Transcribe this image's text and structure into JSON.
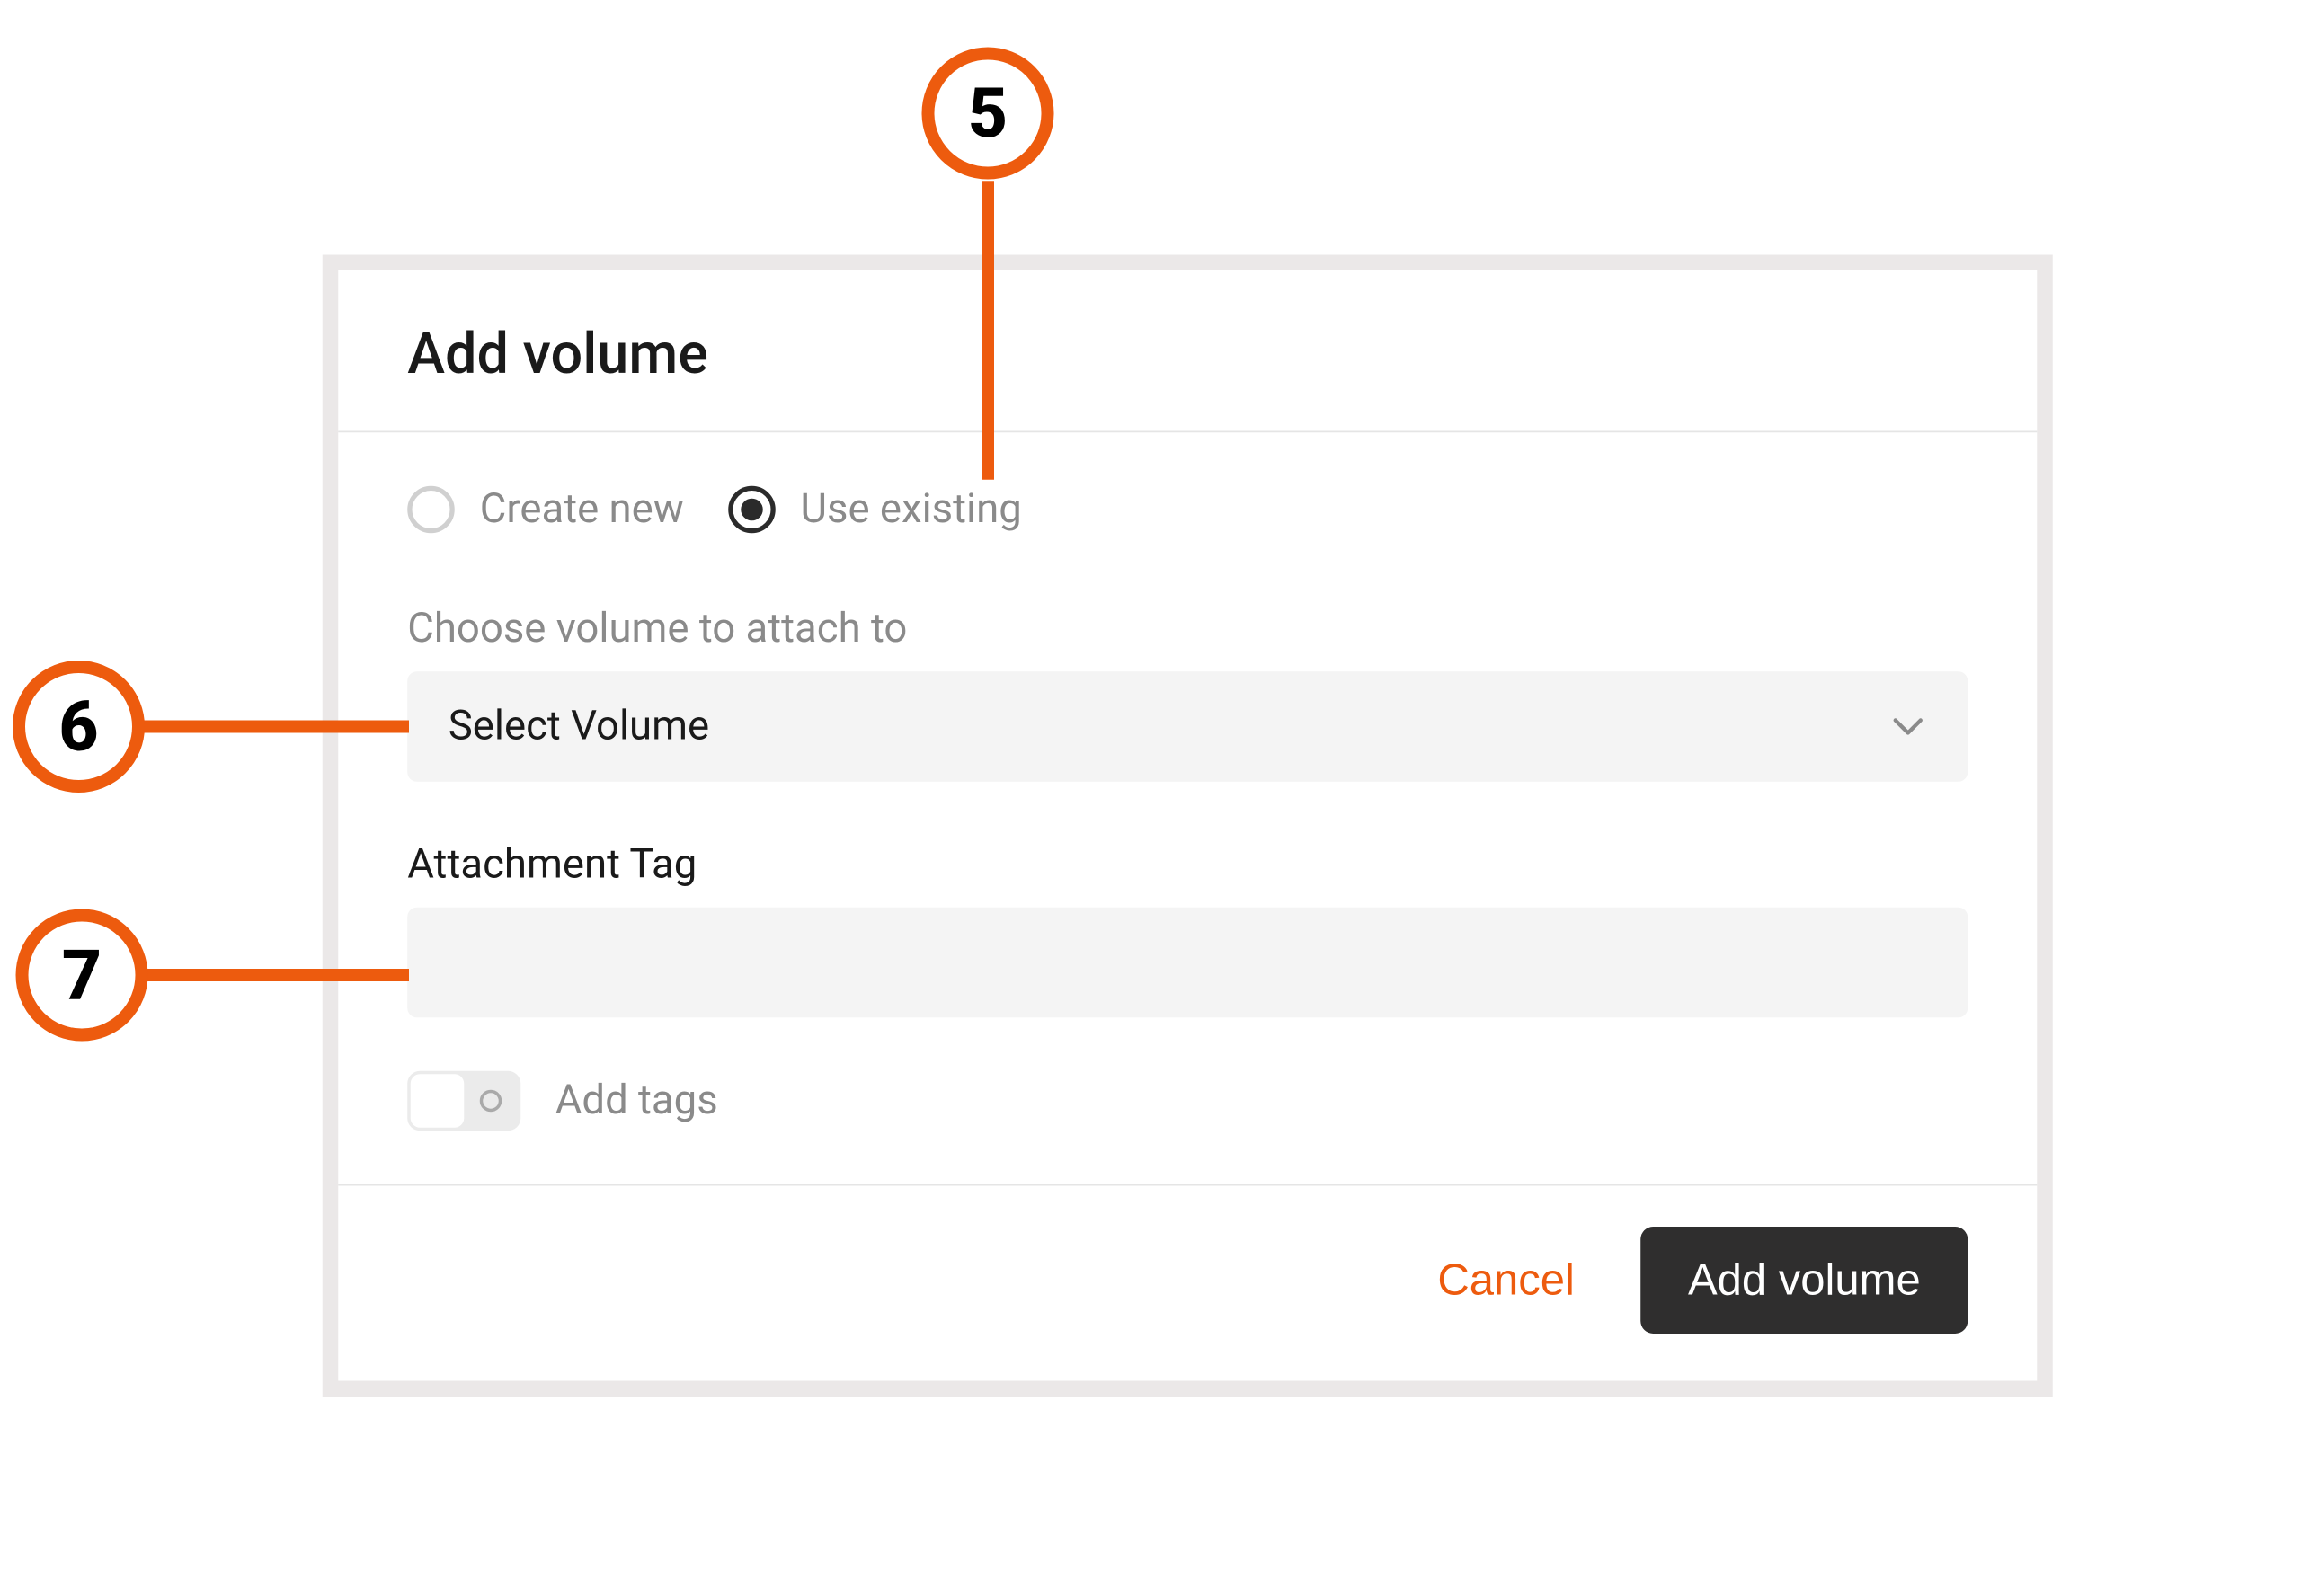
{
  "dialog": {
    "title": "Add volume",
    "radios": {
      "create_new_label": "Create new",
      "use_existing_label": "Use existing"
    },
    "choose_volume_label": "Choose volume to attach to",
    "select_volume_value": "Select Volume",
    "attachment_tag_label": "Attachment Tag",
    "attachment_tag_value": "",
    "add_tags_label": "Add tags",
    "cancel_label": "Cancel",
    "submit_label": "Add volume"
  },
  "callouts": {
    "c5": "5",
    "c6": "6",
    "c7": "7"
  },
  "colors": {
    "accent": "#ed5b0e",
    "button_bg": "#2f2e2e",
    "input_bg": "#f4f4f4",
    "muted_text": "#8a8a8a"
  }
}
